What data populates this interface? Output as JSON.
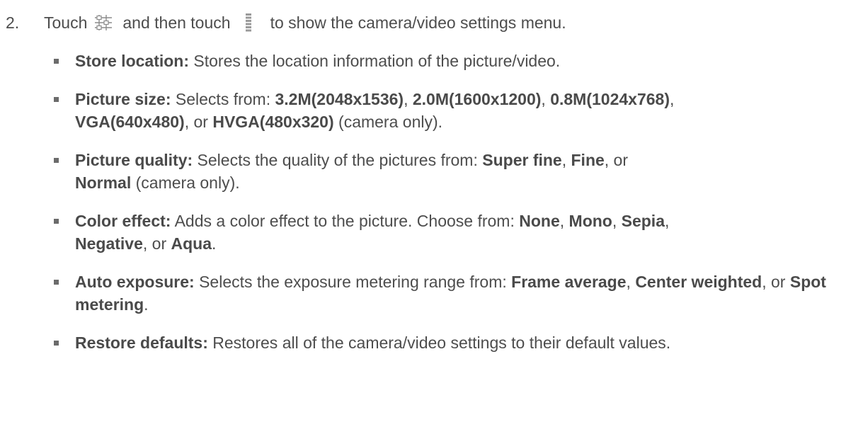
{
  "step": {
    "number": "2.",
    "text_touch": "Touch",
    "icon1": "camera-settings-sliders-icon",
    "text_then": "and then touch",
    "icon2": "menu-handle-icon",
    "text_after": "to show the camera/video settings menu."
  },
  "bullets": [
    {
      "label": "Store location:",
      "text1": " Stores the location information of the picture/video."
    },
    {
      "label": "Picture size:",
      "text1": " Selects from: ",
      "o1": "3.2M(2048x1536)",
      "s1": ", ",
      "o2": "2.0M(1600x1200)",
      "s2": ", ",
      "o3": "0.8M(1024x768)",
      "s3": ",",
      "o4": "VGA(640x480)",
      "s4": ", or ",
      "o5": "HVGA(480x320)",
      "s5": " (camera only)."
    },
    {
      "label": "Picture quality:",
      "text1": " Selects the quality of the pictures from: ",
      "o1": "Super fine",
      "s1": ", ",
      "o2": "Fine",
      "s2": ", or",
      "o3": "Normal",
      "s3": " (camera only)."
    },
    {
      "label": "Color effect:",
      "text1": " Adds a color effect to the picture. Choose from: ",
      "o1": "None",
      "s1": ", ",
      "o2": "Mono",
      "s2": ", ",
      "o3": "Sepia",
      "s3": ",",
      "o4": "Negative",
      "s4": ", or ",
      "o5": "Aqua",
      "s5": "."
    },
    {
      "label": "Auto exposure:",
      "text1": " Selects the exposure metering range from: ",
      "o1": "Frame average",
      "s1": ", ",
      "o2": "Center weighted",
      "s2": ", or ",
      "o3": "Spot metering",
      "s3": "."
    },
    {
      "label": "Restore defaults:",
      "text1": " Restores all of the camera/video settings to their default values."
    }
  ]
}
